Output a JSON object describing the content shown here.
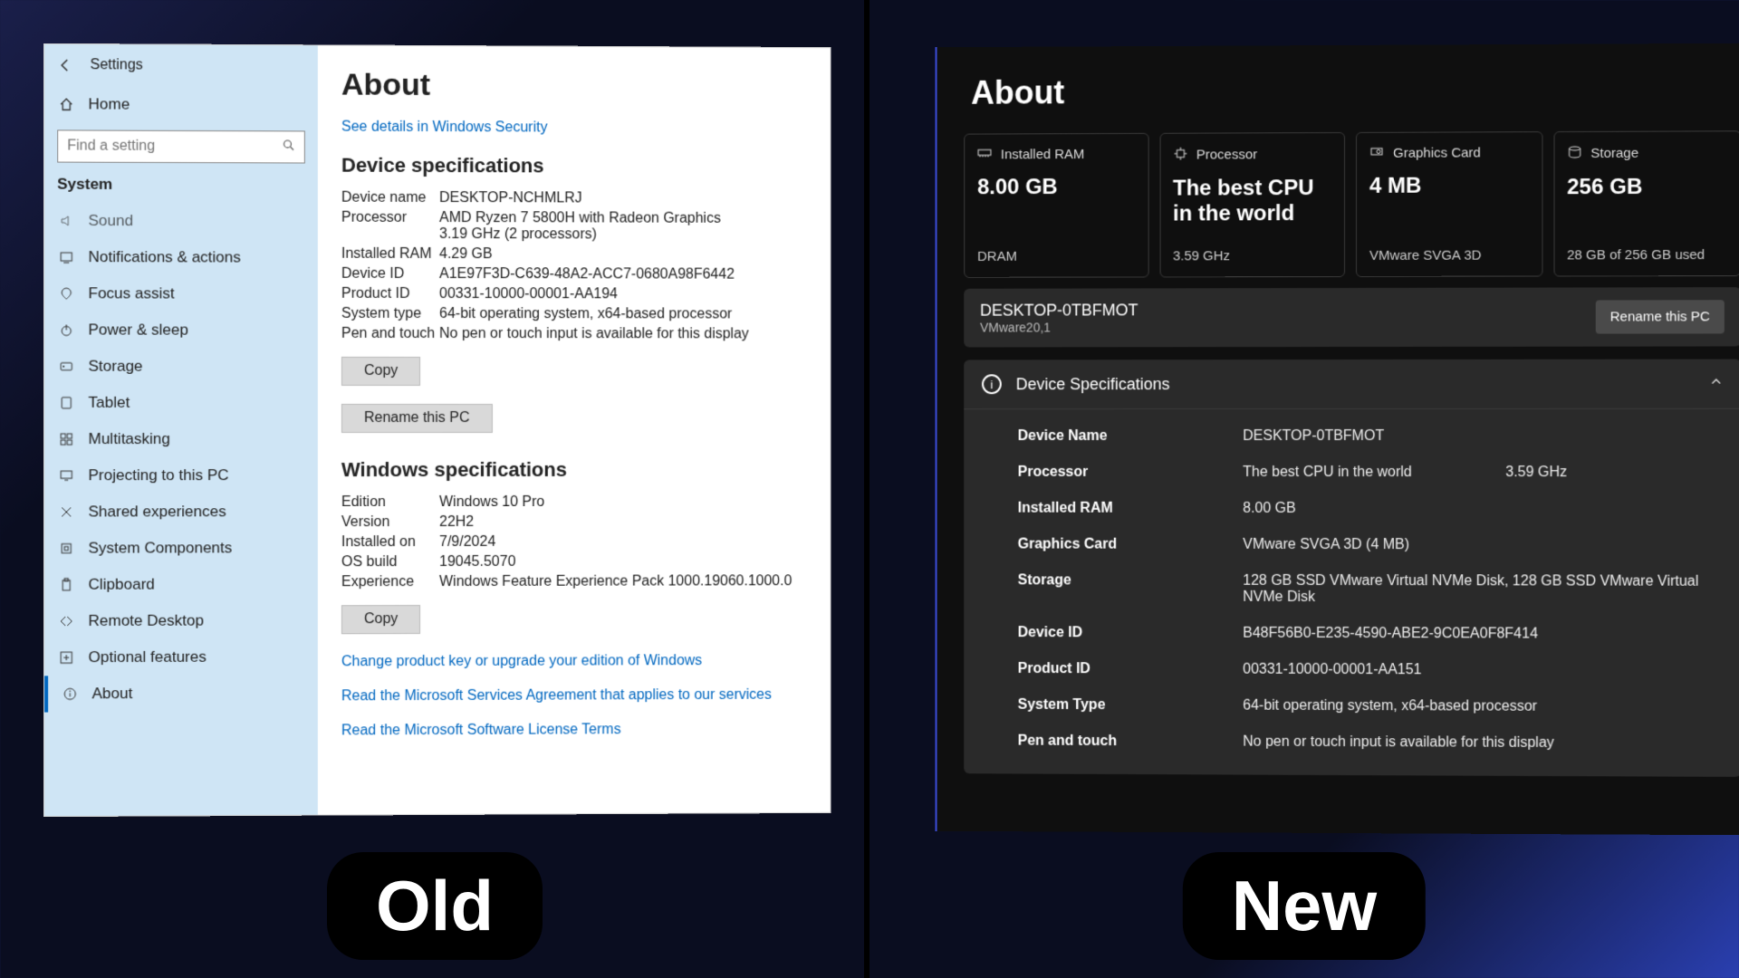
{
  "badge": {
    "old": "Old",
    "new": "New"
  },
  "old": {
    "title": "Settings",
    "home": "Home",
    "search_placeholder": "Find a setting",
    "category": "System",
    "nav": [
      {
        "icon": "sound",
        "label": "Sound",
        "dim": true
      },
      {
        "icon": "notif",
        "label": "Notifications & actions"
      },
      {
        "icon": "focus",
        "label": "Focus assist"
      },
      {
        "icon": "power",
        "label": "Power & sleep"
      },
      {
        "icon": "storage",
        "label": "Storage"
      },
      {
        "icon": "tablet",
        "label": "Tablet"
      },
      {
        "icon": "multitask",
        "label": "Multitasking"
      },
      {
        "icon": "project",
        "label": "Projecting to this PC"
      },
      {
        "icon": "shared",
        "label": "Shared experiences"
      },
      {
        "icon": "components",
        "label": "System Components"
      },
      {
        "icon": "clipboard",
        "label": "Clipboard"
      },
      {
        "icon": "remote",
        "label": "Remote Desktop"
      },
      {
        "icon": "optional",
        "label": "Optional features"
      },
      {
        "icon": "about",
        "label": "About",
        "accent": true
      }
    ],
    "about_heading": "About",
    "security_link": "See details in Windows Security",
    "dev_spec_heading": "Device specifications",
    "dev_spec": {
      "device_name_k": "Device name",
      "device_name_v": "DESKTOP-NCHMLRJ",
      "processor_k": "Processor",
      "processor_v1": "AMD Ryzen 7 5800H with Radeon Graphics",
      "processor_v2": "3.19 GHz  (2 processors)",
      "ram_k": "Installed RAM",
      "ram_v": "4.29 GB",
      "device_id_k": "Device ID",
      "device_id_v": "A1E97F3D-C639-48A2-ACC7-0680A98F6442",
      "product_id_k": "Product ID",
      "product_id_v": "00331-10000-00001-AA194",
      "system_type_k": "System type",
      "system_type_v": "64-bit operating system, x64-based processor",
      "pen_k": "Pen and touch",
      "pen_v": "No pen or touch input is available for this display"
    },
    "btn_copy": "Copy",
    "btn_rename": "Rename this PC",
    "win_spec_heading": "Windows specifications",
    "win_spec": {
      "edition_k": "Edition",
      "edition_v": "Windows 10 Pro",
      "version_k": "Version",
      "version_v": "22H2",
      "installed_k": "Installed on",
      "installed_v": "7/9/2024",
      "build_k": "OS build",
      "build_v": "19045.5070",
      "experience_k": "Experience",
      "experience_v": "Windows Feature Experience Pack 1000.19060.1000.0"
    },
    "links": {
      "product_key": "Change product key or upgrade your edition of Windows",
      "services": "Read the Microsoft Services Agreement that applies to our services",
      "license": "Read the Microsoft Software License Terms"
    }
  },
  "new": {
    "about_heading": "About",
    "cards": [
      {
        "icon": "ram",
        "title": "Installed RAM",
        "main": "8.00 GB",
        "sub": "DRAM"
      },
      {
        "icon": "cpu",
        "title": "Processor",
        "main": "The best CPU in the world",
        "sub": "3.59 GHz"
      },
      {
        "icon": "gpu",
        "title": "Graphics Card",
        "main": "4 MB",
        "sub": "VMware SVGA 3D"
      },
      {
        "icon": "storage",
        "title": "Storage",
        "main": "256 GB",
        "sub": "28 GB of 256 GB used"
      }
    ],
    "device_name": "DESKTOP-0TBFMOT",
    "vm_name": "VMware20,1",
    "btn_rename": "Rename this PC",
    "spec_heading": "Device Specifications",
    "spec": {
      "device_name_k": "Device Name",
      "device_name_v": "DESKTOP-0TBFMOT",
      "processor_k": "Processor",
      "processor_v": "The best CPU in the world",
      "processor_v2": "3.59 GHz",
      "ram_k": "Installed RAM",
      "ram_v": "8.00 GB",
      "gpu_k": "Graphics Card",
      "gpu_v": "VMware SVGA 3D (4 MB)",
      "storage_k": "Storage",
      "storage_v": "128 GB SSD VMware Virtual NVMe Disk, 128 GB SSD VMware Virtual NVMe Disk",
      "device_id_k": "Device ID",
      "device_id_v": "B48F56B0-E235-4590-ABE2-9C0EA0F8F414",
      "product_id_k": "Product ID",
      "product_id_v": "00331-10000-00001-AA151",
      "system_type_k": "System Type",
      "system_type_v": "64-bit operating system, x64-based processor",
      "pen_k": "Pen and touch",
      "pen_v": "No pen or touch input is available for this display"
    }
  }
}
